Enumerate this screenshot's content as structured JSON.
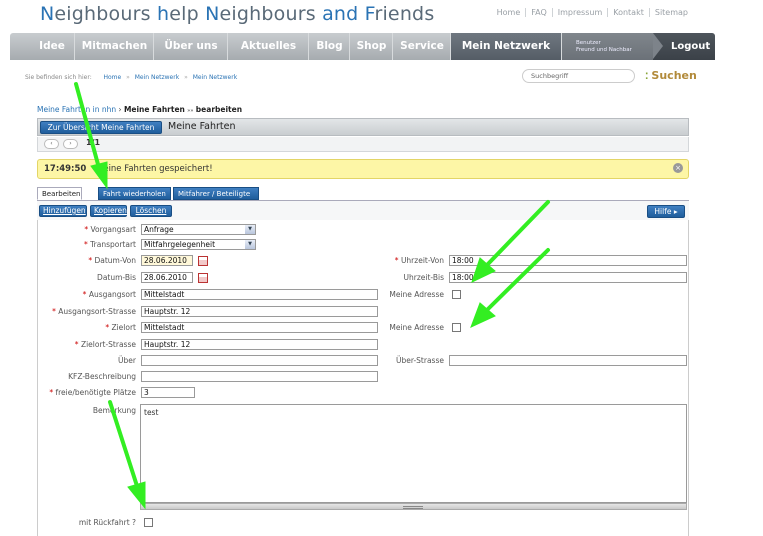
{
  "brand": {
    "parts": [
      {
        "t": "N",
        "hl": true
      },
      {
        "t": "eighbours ",
        "hl": false
      },
      {
        "t": "h",
        "hl": true
      },
      {
        "t": "elp ",
        "hl": false
      },
      {
        "t": "N",
        "hl": true
      },
      {
        "t": "eighbours ",
        "hl": false
      },
      {
        "t": "and F",
        "hl": true
      },
      {
        "t": "riends",
        "hl": false
      }
    ]
  },
  "toplinks": [
    "Home",
    "FAQ",
    "Impressum",
    "Kontakt",
    "Sitemap"
  ],
  "nav": {
    "items": [
      "Idee",
      "Mitmachen",
      "Über uns",
      "Aktuelles",
      "Blog",
      "Shop",
      "Service",
      "Mein Netzwerk"
    ],
    "user_line1": "Benutzer",
    "user_line2": "Freund und Nachbar",
    "logout": "Logout"
  },
  "breadcrumb": {
    "prefix": "Sie befinden sich hier:",
    "items": [
      "Home",
      "Mein Netzwerk",
      "Mein Netzwerk"
    ]
  },
  "search": {
    "placeholder": "Suchbegriff",
    "button": "Suchen"
  },
  "page": {
    "crumb_link": "Meine Fahrten in nhn",
    "crumb_sep": " › ",
    "crumb_current": "Meine Fahrten",
    "crumb_current_suffix": "bearbeiten",
    "back_button": "Zur Übersicht Meine Fahrten",
    "title": "Meine Fahrten",
    "pager_prev": "‹",
    "pager_next": "›",
    "pager_count": "1/1"
  },
  "message": {
    "time": "17:49:50",
    "text": "Meine Fahrten gespeichert!"
  },
  "tabs": [
    "Bearbeiten",
    "Fahrt wiederholen",
    "Mitfahrer / Beteiligte"
  ],
  "toolbar": {
    "add": "Hinzufügen",
    "copy": "Kopieren",
    "delete": "Löschen",
    "help": "Hilfe ▸"
  },
  "form": {
    "vorgangsart": {
      "label": "Vorgangsart",
      "value": "Anfrage"
    },
    "transportart": {
      "label": "Transportart",
      "value": "Mitfahrgelegenheit"
    },
    "datum_von": {
      "label": "Datum-Von",
      "value": "28.06.2010"
    },
    "datum_bis": {
      "label": "Datum-Bis",
      "value": "28.06.2010"
    },
    "uhrzeit_von": {
      "label": "Uhrzeit-Von",
      "value": "18:00"
    },
    "uhrzeit_bis": {
      "label": "Uhrzeit-Bis",
      "value": "18:00"
    },
    "ausgangsort": {
      "label": "Ausgangsort",
      "value": "Mittelstadt"
    },
    "meine_adresse_1": {
      "label": "Meine Adresse"
    },
    "ausgangsort_strasse": {
      "label": "Ausgangsort-Strasse",
      "value": "Hauptstr. 12"
    },
    "zielort": {
      "label": "Zielort",
      "value": "Mittelstadt"
    },
    "meine_adresse_2": {
      "label": "Meine Adresse"
    },
    "zielort_strasse": {
      "label": "Zielort-Strasse",
      "value": "Hauptstr. 12"
    },
    "ueber": {
      "label": "Über",
      "value": ""
    },
    "ueber_strasse": {
      "label": "Über-Strasse",
      "value": ""
    },
    "kfz": {
      "label": "KFZ-Beschreibung",
      "value": ""
    },
    "plaetze": {
      "label": "freie/benötigte Plätze",
      "value": "3"
    },
    "bemerkung": {
      "label": "Bemerkung",
      "value": "test"
    },
    "rueckfahrt": {
      "label": "mit Rückfahrt ?"
    }
  },
  "colors": {
    "accent": "#2a73b4",
    "annotation_arrow": "#33ee22",
    "message_bg": "#fdf6a6"
  }
}
